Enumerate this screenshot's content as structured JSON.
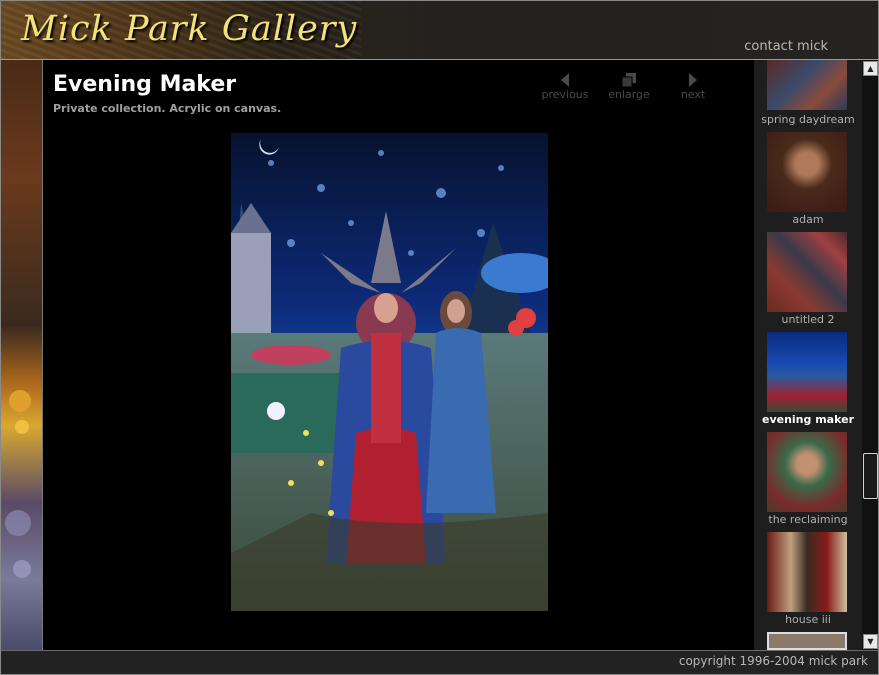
{
  "header": {
    "logo_text": "Mick Park Gallery",
    "contact_label": "contact mick"
  },
  "artwork": {
    "title": "Evening Maker",
    "caption": "Private collection. Acrylic on canvas."
  },
  "nav": {
    "previous": "previous",
    "enlarge": "enlarge",
    "next": "next"
  },
  "thumbnails": [
    {
      "label": "spring daydream"
    },
    {
      "label": "adam"
    },
    {
      "label": "untitled 2"
    },
    {
      "label": "evening maker",
      "selected": true
    },
    {
      "label": "the reclaiming"
    },
    {
      "label": "house iii"
    }
  ],
  "footer": {
    "copyright": "copyright 1996-2004 mick park"
  },
  "colors": {
    "logo": "#f3e27a",
    "title": "#ffffff",
    "background": "#000000"
  }
}
